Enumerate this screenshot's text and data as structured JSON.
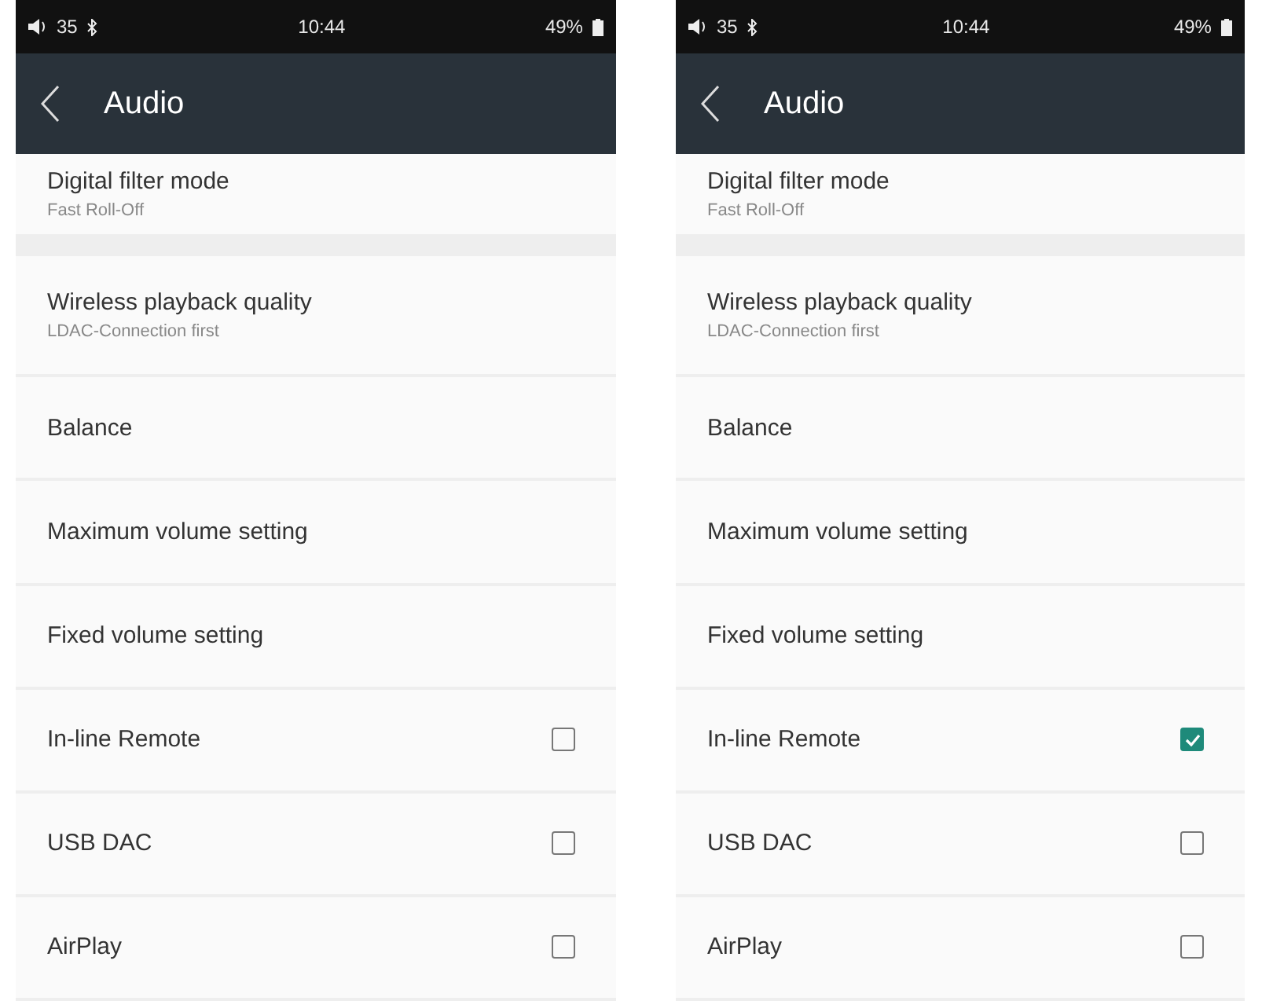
{
  "phones": [
    {
      "status_bar": {
        "volume": "35",
        "time": "10:44",
        "battery": "49%"
      },
      "header": {
        "title": "Audio"
      },
      "items": [
        {
          "kind": "subtitle",
          "title": "Digital filter mode",
          "subtitle": "Fast Roll-Off",
          "section_end": true
        },
        {
          "kind": "subtitle",
          "title": "Wireless playback quality",
          "subtitle": "LDAC-Connection first"
        },
        {
          "kind": "plain",
          "title": "Balance"
        },
        {
          "kind": "plain",
          "title": "Maximum volume setting"
        },
        {
          "kind": "plain",
          "title": "Fixed volume setting"
        },
        {
          "kind": "checkbox",
          "title": "In-line Remote",
          "checked": false
        },
        {
          "kind": "checkbox",
          "title": "USB DAC",
          "checked": false
        },
        {
          "kind": "checkbox",
          "title": "AirPlay",
          "checked": false
        }
      ]
    },
    {
      "status_bar": {
        "volume": "35",
        "time": "10:44",
        "battery": "49%"
      },
      "header": {
        "title": "Audio"
      },
      "items": [
        {
          "kind": "subtitle",
          "title": "Digital filter mode",
          "subtitle": "Fast Roll-Off",
          "section_end": true
        },
        {
          "kind": "subtitle",
          "title": "Wireless playback quality",
          "subtitle": "LDAC-Connection first"
        },
        {
          "kind": "plain",
          "title": "Balance"
        },
        {
          "kind": "plain",
          "title": "Maximum volume setting"
        },
        {
          "kind": "plain",
          "title": "Fixed volume setting"
        },
        {
          "kind": "checkbox",
          "title": "In-line Remote",
          "checked": true
        },
        {
          "kind": "checkbox",
          "title": "USB DAC",
          "checked": false
        },
        {
          "kind": "checkbox",
          "title": "AirPlay",
          "checked": false
        }
      ]
    }
  ]
}
